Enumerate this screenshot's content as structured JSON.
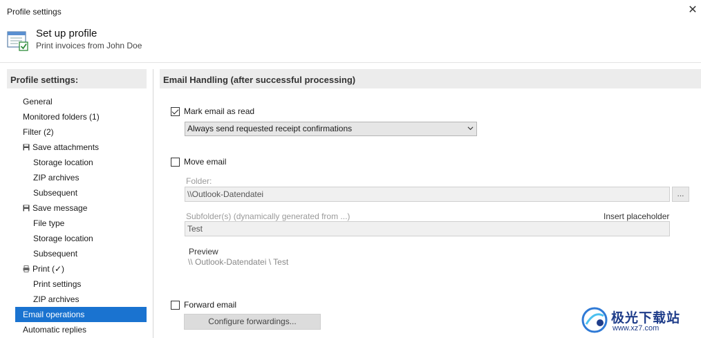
{
  "window": {
    "title": "Profile settings",
    "close_glyph": "✕"
  },
  "header": {
    "title": "Set up profile",
    "subtitle": "Print invoices from John Doe"
  },
  "sidebar": {
    "heading": "Profile settings:",
    "items": [
      {
        "label": "General",
        "level": 0,
        "icon": null
      },
      {
        "label": "Monitored folders (1)",
        "level": 0,
        "icon": null
      },
      {
        "label": "Filter (2)",
        "level": 0,
        "icon": null
      },
      {
        "label": "Save attachments",
        "level": 0,
        "icon": "floppy-icon"
      },
      {
        "label": "Storage location",
        "level": 1,
        "icon": null
      },
      {
        "label": "ZIP archives",
        "level": 1,
        "icon": null
      },
      {
        "label": "Subsequent",
        "level": 1,
        "icon": null
      },
      {
        "label": "Save message",
        "level": 0,
        "icon": "floppy-icon"
      },
      {
        "label": "File type",
        "level": 1,
        "icon": null
      },
      {
        "label": "Storage location",
        "level": 1,
        "icon": null
      },
      {
        "label": "Subsequent",
        "level": 1,
        "icon": null
      },
      {
        "label": "Print  (✓)",
        "level": 0,
        "icon": "printer-icon"
      },
      {
        "label": "Print settings",
        "level": 1,
        "icon": null
      },
      {
        "label": "ZIP archives",
        "level": 1,
        "icon": null
      },
      {
        "label": "Email operations",
        "level": 0,
        "icon": null,
        "selected": true
      },
      {
        "label": "Automatic replies",
        "level": 0,
        "icon": null
      }
    ]
  },
  "main": {
    "heading": "Email Handling (after successful processing)",
    "mark_read": {
      "label": "Mark email as read",
      "checked": true
    },
    "receipt_select": {
      "value": "Always send requested receipt confirmations"
    },
    "move_email": {
      "label": "Move email",
      "checked": false
    },
    "folder": {
      "label": "Folder:",
      "value": "\\\\Outlook-Datendatei",
      "browse_label": "..."
    },
    "subfolder": {
      "label": "Subfolder(s) (dynamically generated from ...)",
      "insert_label": "Insert placeholder",
      "value": "Test"
    },
    "preview": {
      "label": "Preview",
      "value": "\\\\ Outlook-Datendatei \\ Test"
    },
    "forward_email": {
      "label": "Forward email",
      "checked": false
    },
    "configure_button": "Configure forwardings..."
  },
  "watermark": {
    "line1": "极光下载站",
    "line2": "www.xz7.com"
  },
  "colors": {
    "selection": "#1a73d0",
    "panel_header": "#ececec",
    "watermark": "#1f3d8a"
  }
}
